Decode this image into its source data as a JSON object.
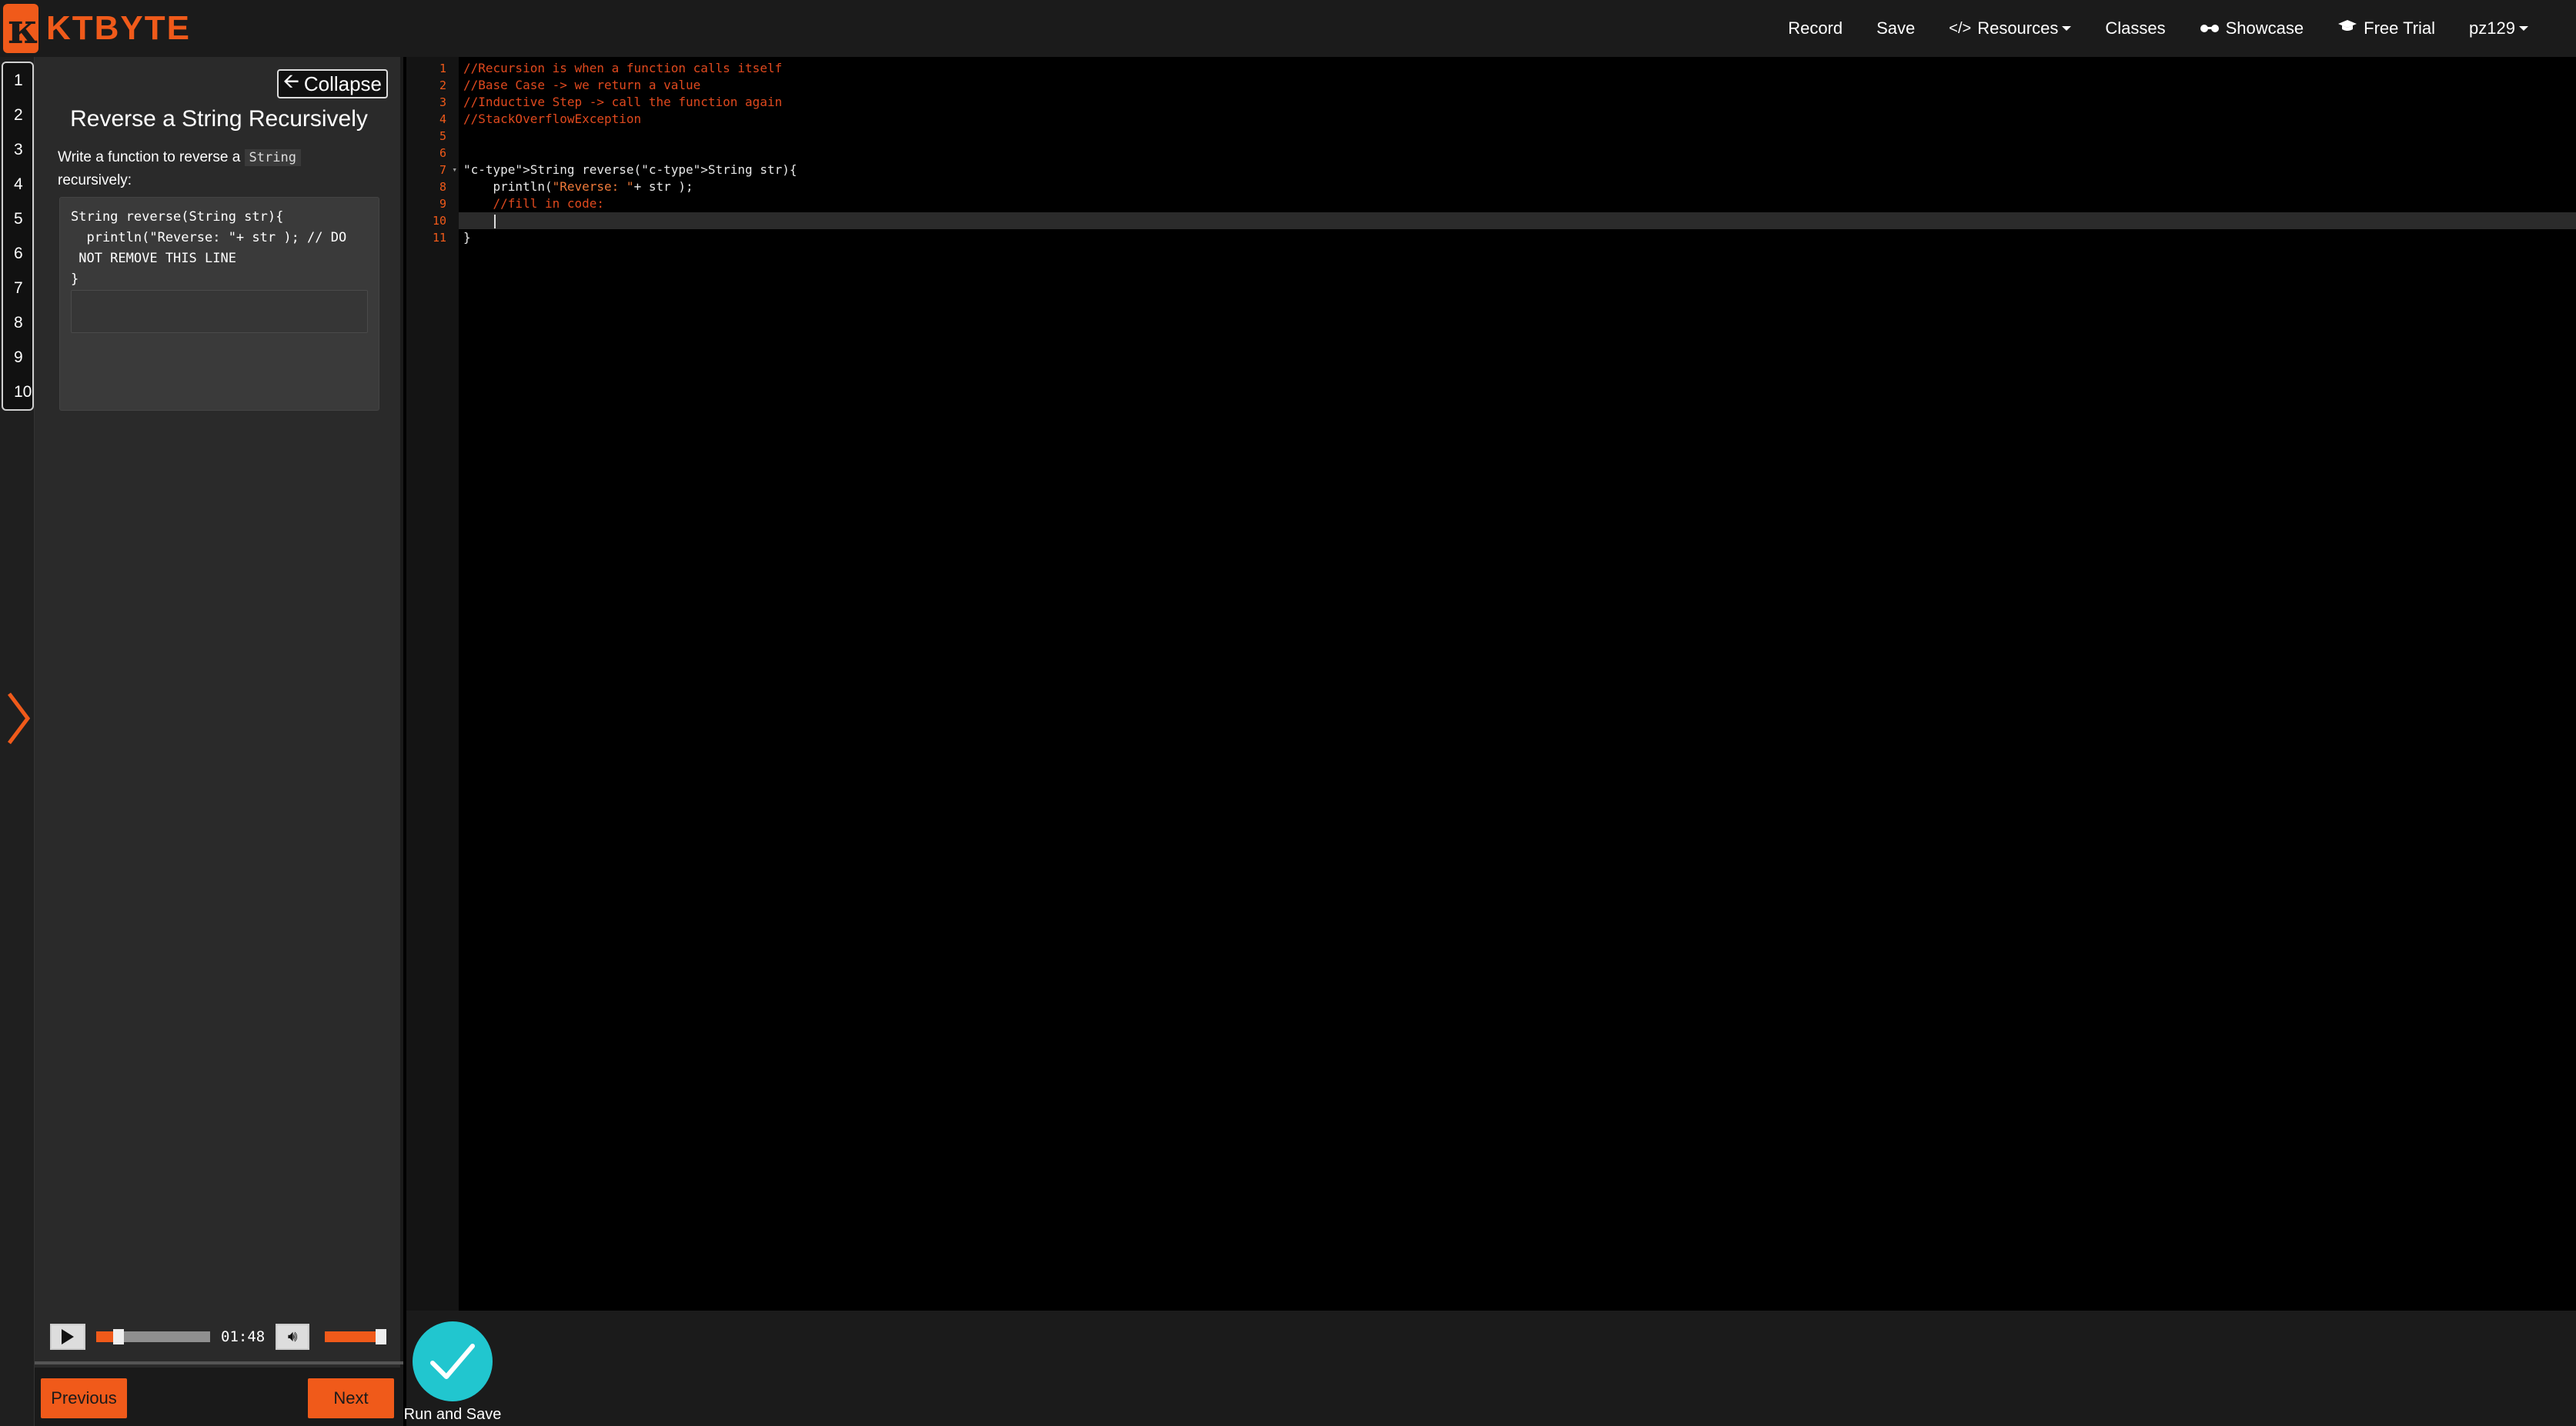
{
  "brand": {
    "logo_glyph": "κ",
    "name": "KTBYTE",
    "color": "#f05a1a"
  },
  "nav": {
    "record": "Record",
    "save": "Save",
    "resources": "Resources",
    "classes": "Classes",
    "showcase": "Showcase",
    "free_trial": "Free Trial",
    "user": "pz129"
  },
  "steps": [
    "1",
    "2",
    "3",
    "4",
    "5",
    "6",
    "7",
    "8",
    "9",
    "10"
  ],
  "panel": {
    "collapse_label": "Collapse",
    "title": "Reverse a String Recursively",
    "desc_before": "Write a function to reverse a ",
    "desc_code": "String",
    "desc_after": " recursively:",
    "code": "String reverse(String str){\n  println(\"Reverse: \"+ str ); // DO\n NOT REMOVE THIS LINE\n}"
  },
  "player": {
    "time": "01:48",
    "progress": 0.15,
    "volume": 0.82
  },
  "buttons": {
    "previous": "Previous",
    "next": "Next",
    "run_and_save": "Run and Save"
  },
  "editor": {
    "line_numbers": [
      "1",
      "2",
      "3",
      "4",
      "5",
      "6",
      "7",
      "8",
      "9",
      "10",
      "11"
    ],
    "lines": [
      "//Recursion is when a function calls itself",
      "//Base Case -> we return a value",
      "//Inductive Step -> call the function again",
      "//StackOverflowException",
      "",
      "",
      "String reverse(String str){",
      "    println(\"Reverse: \"+ str );",
      "    //fill in code:",
      "",
      "}"
    ],
    "active_line": 10
  },
  "colors": {
    "accent": "#f05a1a",
    "run": "#21c6cf",
    "comment": "#e0491e",
    "keyword": "#8fb3ff"
  }
}
